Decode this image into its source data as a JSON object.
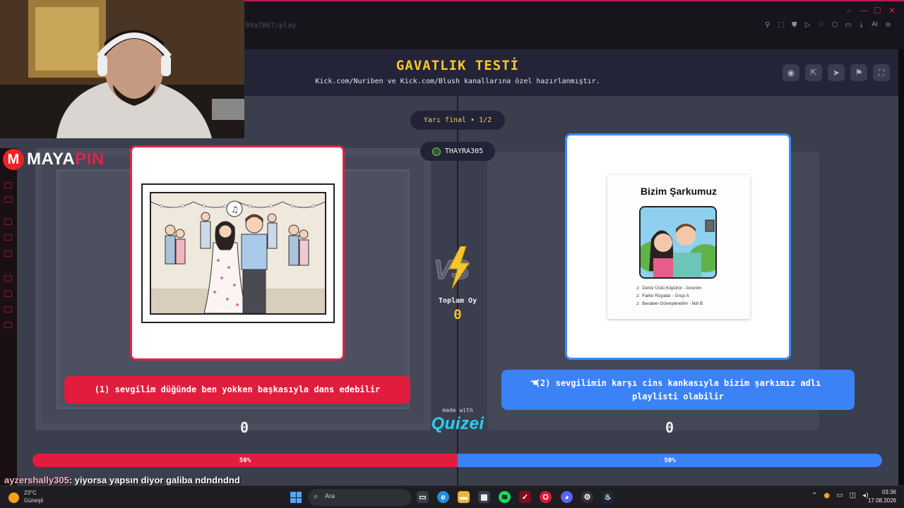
{
  "browser": {
    "url": "99a7867/play",
    "ai_label": "AI"
  },
  "app": {
    "title": "GAVATLIK TESTİ",
    "subtitle": "Kick.com/Nuriben ve Kick.com/Blush kanallarına özel hazırlanmıştır.",
    "header_icons": [
      "eye-icon",
      "share-icon",
      "send-icon",
      "flag-icon",
      "fullscreen-icon"
    ]
  },
  "round": {
    "label": "Yarı final • 1/2",
    "user": "THAYRA305"
  },
  "left_option": {
    "label": "(1) sevgilim düğünde ben yokken başkasıyla dans edebilir",
    "score": "0",
    "percent_label": "50%",
    "percent": 50,
    "color": "#e11d3e"
  },
  "right_option": {
    "label": "(2) sevgilimin karşı cins kankasıyla bizim şarkımız adlı playlisti olabilir",
    "score": "0",
    "percent_label": "50%",
    "percent": 50,
    "color": "#3b82f6",
    "image": {
      "title": "Bizim Şarkumuz",
      "songs": [
        "Deniz Üstü Köpürür - Anonim",
        "Farklı Rüyalar - Grup A",
        "Beraber Güneşlenelim - İkili B"
      ]
    }
  },
  "center": {
    "vs": "VS",
    "total_label": "Toplam Oy",
    "total_value": "0",
    "made_with": "made with",
    "brand": "Quizei"
  },
  "stream": {
    "logo_left": "MAYA",
    "logo_right": "PIN",
    "chat_user": "ayzershally305",
    "chat_message": ": yiyorsa yapsın diyor galiba ndndndnd"
  },
  "taskbar": {
    "weather_temp": "23°C",
    "weather_desc": "Güneşli",
    "search_placeholder": "Ara",
    "time": "03:36",
    "date": "17.08.2026"
  }
}
